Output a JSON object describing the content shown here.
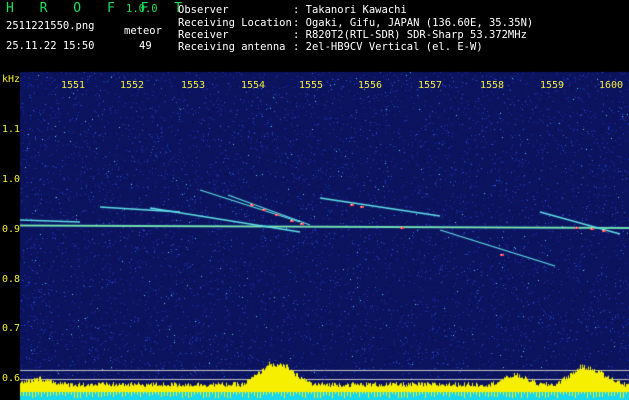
{
  "header": {
    "app_title": "H R O F F T",
    "version": "1.0.0",
    "filename": "2511221550.png",
    "datetime": "25.11.22 15:50",
    "meteor_label": "meteor",
    "meteor_count": "49",
    "info": [
      {
        "label": "Observer",
        "value": ": Takanori Kawachi"
      },
      {
        "label": "Receiving Location",
        "value": ": Ogaki, Gifu, JAPAN (136.60E, 35.35N)"
      },
      {
        "label": "Receiver",
        "value": ": R820T2(RTL-SDR) SDR-Sharp 53.372MHz"
      },
      {
        "label": "Receiving antenna",
        "value": ": 2el-HB9CV Vertical (el. E-W)"
      }
    ]
  },
  "axis": {
    "unit": "kHz",
    "time_ticks": [
      "1551",
      "1552",
      "1553",
      "1554",
      "1555",
      "1556",
      "1557",
      "1558",
      "1559",
      "1600"
    ],
    "freq_ticks": [
      "1.1",
      "1.0",
      "0.9",
      "0.8",
      "0.7",
      "0.6"
    ]
  },
  "colors": {
    "background": "#000000",
    "noise_blue": "#1a2aa8",
    "carrier": "#4fe8d0",
    "echo_red": "#ff4b4b",
    "level_bar": "#f6f000",
    "baseline": "#16d6f0"
  }
}
